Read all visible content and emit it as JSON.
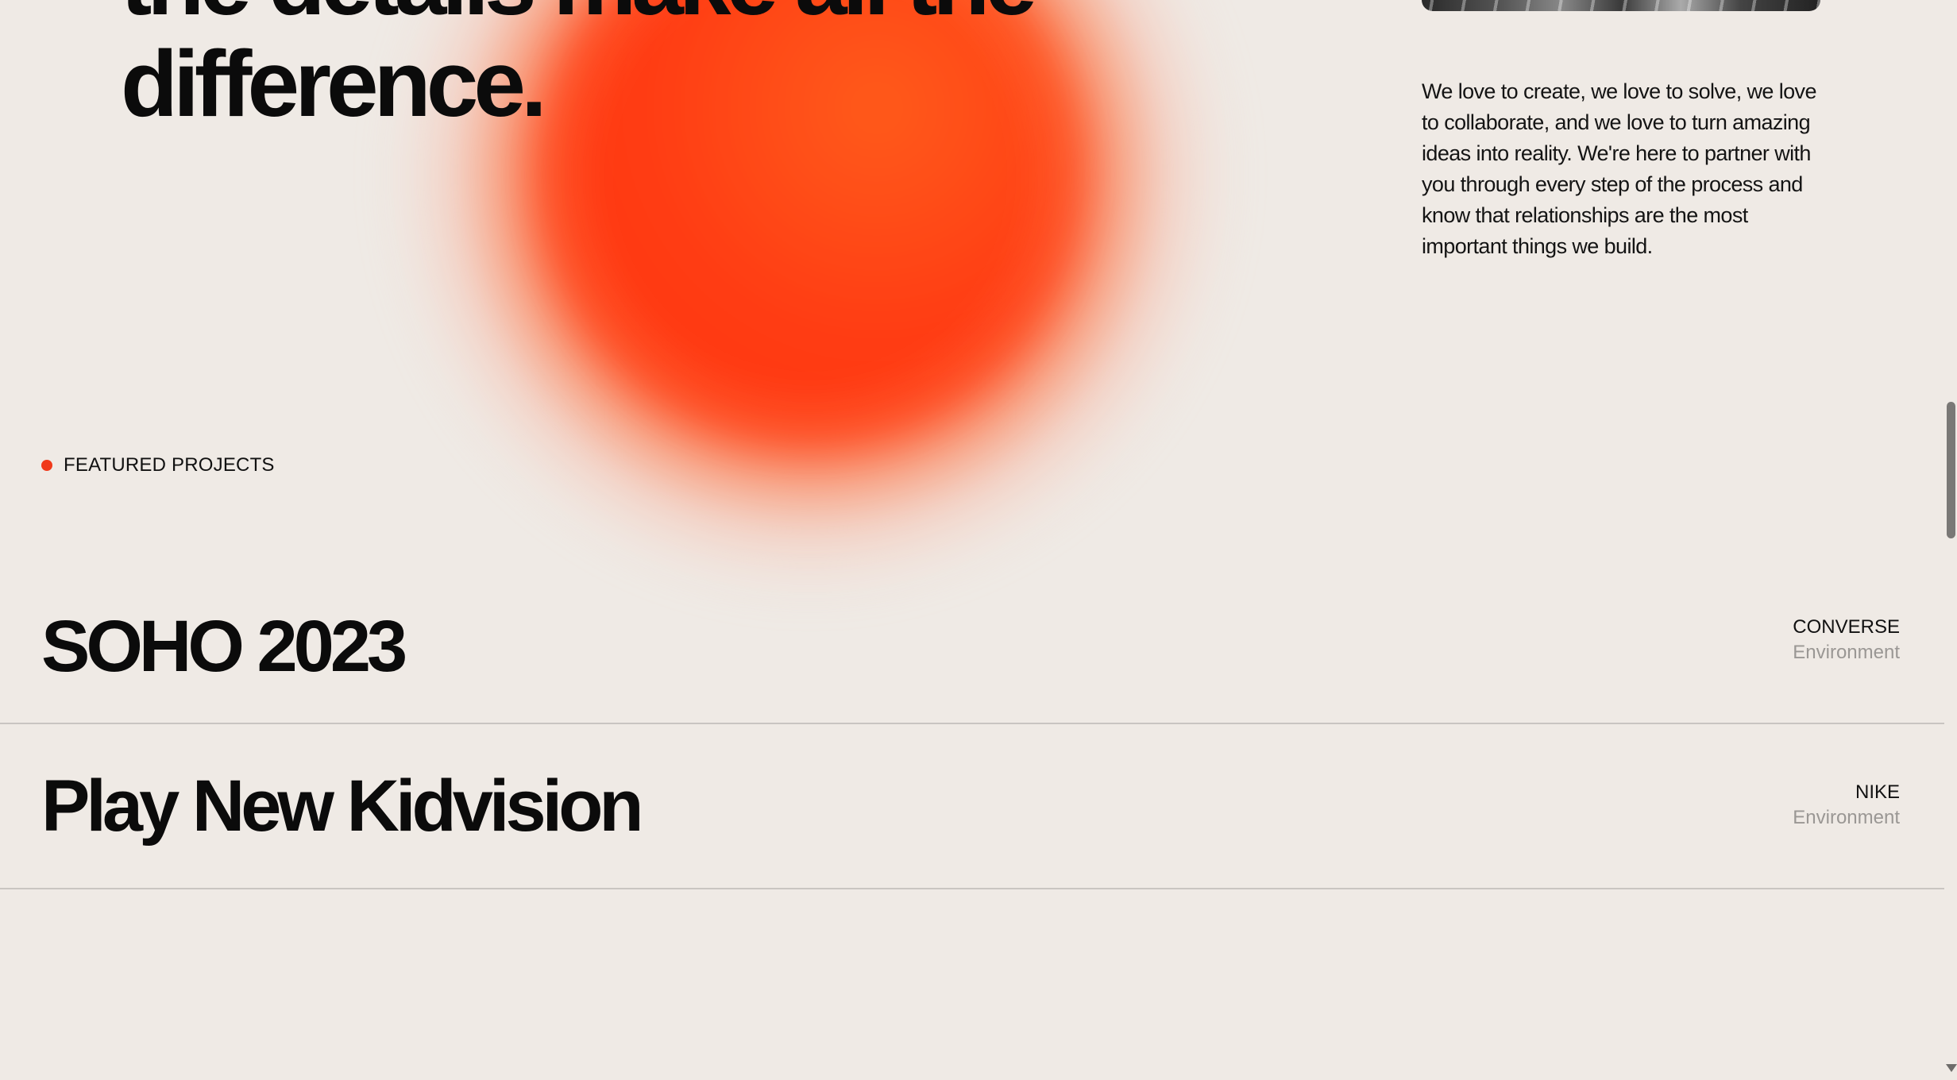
{
  "hero": {
    "headline_line1": "the details make all the",
    "headline_line2": "difference.",
    "intro_text": "We love to create, we love to solve, we love to collaborate, and we love to turn amazing ideas into reality. We're here to partner with you through every step of the process and know that relationships are the most important things we build."
  },
  "featured": {
    "label": "FEATURED PROJECTS",
    "projects": [
      {
        "title": "SOHO 2023",
        "client": "CONVERSE",
        "category": "Environment"
      },
      {
        "title": "Play New Kidvision",
        "client": "NIKE",
        "category": "Environment"
      }
    ]
  },
  "colors": {
    "background": "#efeae5",
    "accent": "#f0391a",
    "text": "#0b0b0b",
    "muted": "#9a9794",
    "divider": "#c9c5c1"
  },
  "icons": {
    "bullet": "red-dot-icon",
    "scroll_down": "scroll-down-arrow-icon"
  }
}
